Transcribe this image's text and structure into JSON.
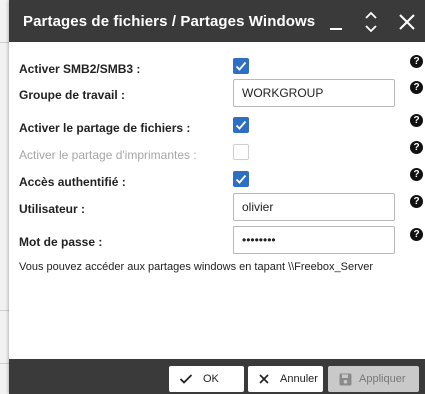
{
  "dialog": {
    "title": "Partages de fichiers / Partages Windows"
  },
  "form": {
    "smb": {
      "label": "Activer SMB2/SMB3 :",
      "checked": true
    },
    "workgroup": {
      "label": "Groupe de travail :",
      "value": "WORKGROUP"
    },
    "file_sharing": {
      "label": "Activer le partage de fichiers :",
      "checked": true
    },
    "printer_sharing": {
      "label": "Activer le partage d'imprimantes :",
      "checked": false,
      "disabled": true
    },
    "auth": {
      "label": "Accès authentifié :",
      "checked": true
    },
    "user": {
      "label": "Utilisateur :",
      "value": "olivier"
    },
    "password": {
      "label": "Mot de passe :",
      "value": "password"
    },
    "help_glyph": "?"
  },
  "info_text": "Vous pouvez accéder aux partages windows en tapant \\\\Freebox_Server",
  "footer": {
    "ok_label": "OK",
    "cancel_label": "Annuler",
    "apply_label": "Appliquer"
  },
  "colors": {
    "titlebar": "#3a3a3a",
    "checkbox_checked": "#2e6fc4",
    "apply_disabled": "#c9c9c9"
  },
  "icons": [
    "minimize-icon",
    "collapse-icon",
    "close-icon",
    "check-icon",
    "help-icon",
    "ok-check-icon",
    "cancel-x-icon",
    "save-icon"
  ]
}
